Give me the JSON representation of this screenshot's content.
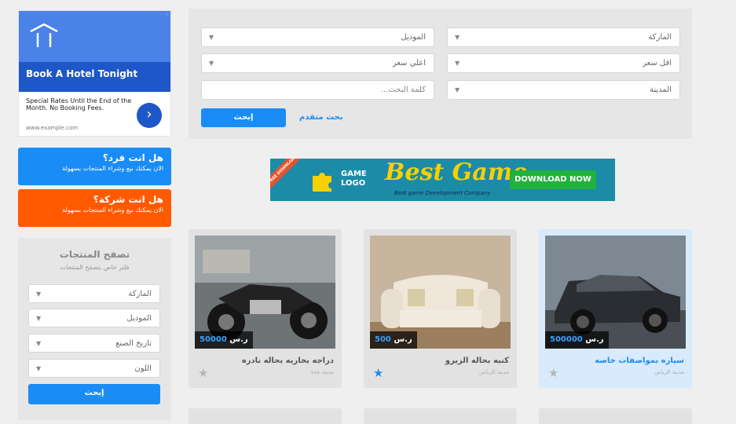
{
  "ad": {
    "title": "Book A Hotel Tonight",
    "text": "Special Rates Until the End of the Month. No Booking Fees.",
    "url": "www.example.com",
    "go": "›",
    "adchoice": "▷✕"
  },
  "cta": [
    {
      "title": "هل انت فرد؟",
      "sub": "الان يمكنك بيع وشراء المنتجات بسهولة",
      "color": "#1a8cf5"
    },
    {
      "title": "هل انت شركة؟",
      "sub": "الان يمكنك بيع وشراء المنتجات بسهولة",
      "color": "#ff5a00"
    }
  ],
  "browse": {
    "title": "تصفح المنتجات",
    "subtitle": "فلتر خاص بتصفح المنتجات",
    "selects": [
      "الماركة",
      "الموديل",
      "تاريخ الصنع",
      "اللون"
    ],
    "button": "إبحث"
  },
  "search": {
    "brand": "الماركة",
    "model": "الموديل",
    "min_price": "اقل سعر",
    "max_price": "اعلي سعر",
    "city": "المدينة",
    "keyword_placeholder": "كلمة البحث...",
    "button": "إبحث",
    "advanced": "بحث متقدم"
  },
  "banner": {
    "ribbon": "FREE DOWNLOAD",
    "logo_line1": "GAME",
    "logo_line2": "LOGO",
    "headline": "Best Game",
    "tagline": "Best game Development Company",
    "cta": "DOWNLOAD NOW"
  },
  "products": [
    {
      "title": "سياره بمواصفات خاصه",
      "city": "مدينة الرياض",
      "price": "500000",
      "currency": "ر.س",
      "favorite": false,
      "highlight": true
    },
    {
      "title": "كنبه بحاله الزيرو",
      "city": "مدينة الرياض",
      "price": "500",
      "currency": "ر.س",
      "favorite": true,
      "highlight": false
    },
    {
      "title": "دراجه بخاريه بحاله نادره",
      "city": "مدينة جدة",
      "price": "50000",
      "currency": "ر.س",
      "favorite": false,
      "highlight": false
    }
  ],
  "colors": {
    "accent": "#1a8cf5",
    "orange": "#ff5a00",
    "highlight": "#d8eafb"
  }
}
